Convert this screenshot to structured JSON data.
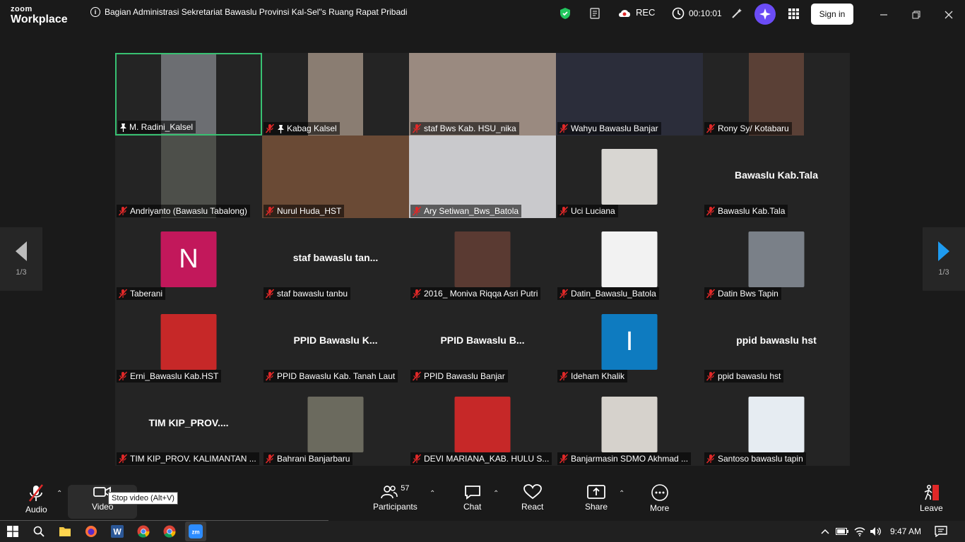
{
  "app": {
    "logo_top": "zoom",
    "logo_bottom": "Workplace"
  },
  "meeting": {
    "title": "Bagian Administrasi Sekretariat Bawaslu Provinsi Kal-Sel\"s Ruang Rapat Pribadi"
  },
  "header": {
    "rec_label": "REC",
    "timer": "00:10:01",
    "signin_label": "Sign in"
  },
  "gallery": {
    "page_indicator": "1/3",
    "tiles": [
      {
        "name": "M. Radini_Kalsel",
        "pinned": true,
        "muted": false,
        "type": "video",
        "active": true,
        "bg": "#6c6e72"
      },
      {
        "name": "Kabag Kalsel",
        "pinned": true,
        "muted": true,
        "type": "video",
        "bg": "#8a7d72"
      },
      {
        "name": "staf Bws Kab. HSU_nika",
        "muted": true,
        "type": "video-wide",
        "bg": "#9a8a80"
      },
      {
        "name": "Wahyu Bawaslu Banjar",
        "muted": true,
        "type": "video-wide",
        "bg": "#2b2d3a"
      },
      {
        "name": "Rony Sy/ Kotabaru",
        "muted": true,
        "type": "video",
        "bg": "#5a4036"
      },
      {
        "name": "Andriyanto (Bawaslu Tabalong)",
        "muted": true,
        "type": "video",
        "bg": "#4d4f4a"
      },
      {
        "name": "Nurul Huda_HST",
        "muted": true,
        "type": "video-wide",
        "bg": "#6a4a35"
      },
      {
        "name": "Ary Setiwan_Bws_Batola",
        "muted": true,
        "type": "video-wide",
        "bg": "#c9c9cc"
      },
      {
        "name": "Uci Luciana",
        "muted": true,
        "type": "photo",
        "bg": "#d8d6d2"
      },
      {
        "name": "Bawaslu Kab.Tala",
        "muted": true,
        "type": "text",
        "display": "Bawaslu Kab.Tala"
      },
      {
        "name": "Taberani",
        "muted": true,
        "type": "letter",
        "letter": "N",
        "bg": "#c2185b"
      },
      {
        "name": "staf bawaslu tanbu",
        "muted": true,
        "type": "text",
        "display": "staf bawaslu tan..."
      },
      {
        "name": "2016_ Moniva Riqqa Asri Putri",
        "muted": true,
        "type": "photo",
        "bg": "#5a3a32"
      },
      {
        "name": "Datin_Bawaslu_Batola",
        "muted": true,
        "type": "photo",
        "bg": "#f2f2f2"
      },
      {
        "name": "Datin Bws Tapin",
        "muted": true,
        "type": "photo",
        "bg": "#7a8088"
      },
      {
        "name": "Erni_Bawaslu Kab.HST",
        "muted": true,
        "type": "photo",
        "bg": "#c62828"
      },
      {
        "name": "PPID Bawaslu Kab. Tanah Laut",
        "muted": true,
        "type": "text",
        "display": "PPID Bawaslu K..."
      },
      {
        "name": "PPID  Bawaslu Banjar",
        "muted": true,
        "type": "text",
        "display": "PPID  Bawaslu B..."
      },
      {
        "name": "Ideham Khalik",
        "muted": true,
        "type": "letter",
        "letter": "I",
        "bg": "#0e7bc0"
      },
      {
        "name": "ppid bawaslu hst",
        "muted": true,
        "type": "text",
        "display": "ppid bawaslu hst"
      },
      {
        "name": "TIM KIP_PROV. KALIMANTAN ...",
        "muted": true,
        "type": "text",
        "display": "TIM KIP_PROV...."
      },
      {
        "name": "Bahrani Banjarbaru",
        "muted": true,
        "type": "photo",
        "bg": "#6b6a5e"
      },
      {
        "name": "DEVI MARIANA_KAB. HULU S...",
        "muted": true,
        "type": "photo",
        "bg": "#c62828"
      },
      {
        "name": "Banjarmasin SDMO Akhmad ...",
        "muted": true,
        "type": "photo",
        "bg": "#d6d2cc"
      },
      {
        "name": "Santoso bawaslu tapin",
        "muted": true,
        "type": "photo",
        "bg": "#e6ecf2"
      }
    ]
  },
  "toolbar": {
    "audio": "Audio",
    "video": "Video",
    "participants": "Participants",
    "participant_count": "57",
    "chat": "Chat",
    "react": "React",
    "share": "Share",
    "more": "More",
    "leave": "Leave",
    "tooltip": "Stop video (Alt+V)"
  },
  "taskbar": {
    "time": "9:47 AM"
  },
  "colors": {
    "active_border": "#38c172",
    "muted_mic": "#e02828",
    "rec_dot": "#ffffff",
    "ai_button": "#6b4cf6",
    "shield": "#22c55e",
    "next_arrow": "#1e9bf0"
  }
}
